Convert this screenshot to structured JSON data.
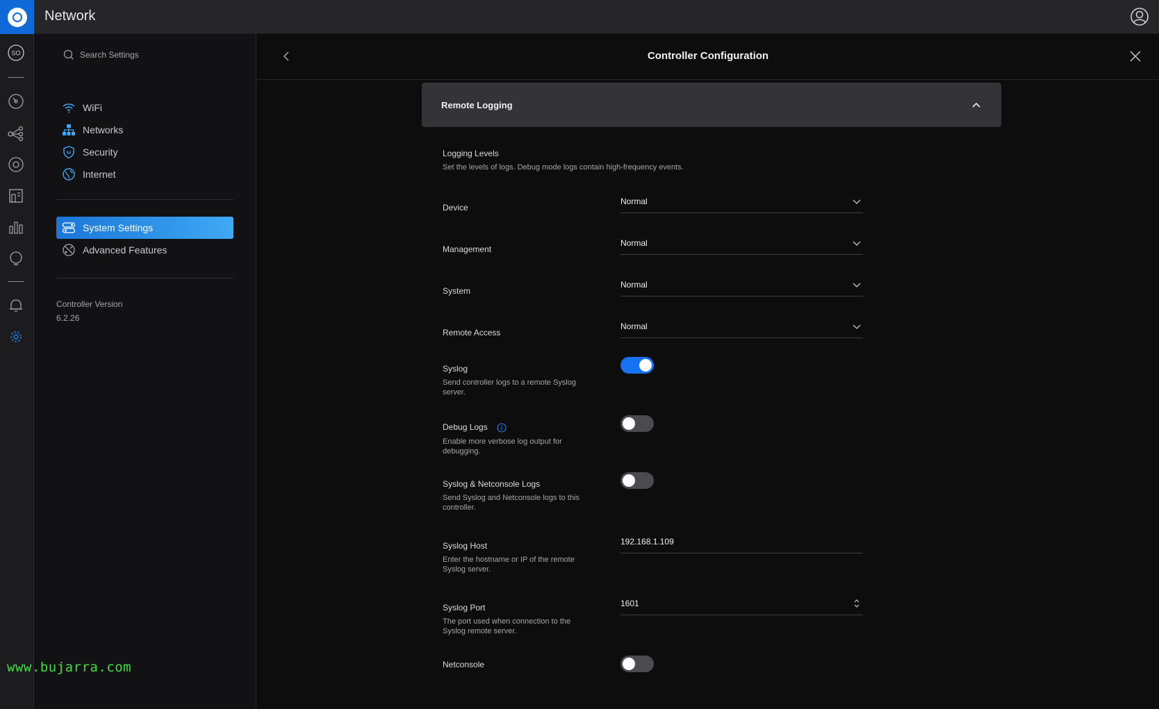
{
  "app": {
    "title": "Network"
  },
  "sidebar": {
    "search_placeholder": "Search Settings",
    "items": [
      {
        "label": "WiFi",
        "icon": "wifi-icon"
      },
      {
        "label": "Networks",
        "icon": "networks-icon"
      },
      {
        "label": "Security",
        "icon": "shield-icon"
      },
      {
        "label": "Internet",
        "icon": "globe-icon"
      }
    ],
    "items2": [
      {
        "label": "System Settings",
        "icon": "system-settings-icon",
        "active": true
      },
      {
        "label": "Advanced Features",
        "icon": "advanced-features-icon"
      }
    ],
    "version_label": "Controller Version",
    "version_value": "6.2.26"
  },
  "leftnav": {
    "icons": [
      "site-switcher-icon",
      "dashboard-icon",
      "topology-icon",
      "devices-icon",
      "clients-icon",
      "statistics-icon",
      "insights-icon",
      "alerts-icon",
      "settings-icon"
    ],
    "site_initials": "SO"
  },
  "main": {
    "title": "Controller Configuration",
    "section_title": "Remote Logging",
    "logging_levels": {
      "label": "Logging Levels",
      "desc": "Set the levels of logs. Debug mode logs contain high-frequency events."
    },
    "selects": [
      {
        "label": "Device",
        "value": "Normal"
      },
      {
        "label": "Management",
        "value": "Normal"
      },
      {
        "label": "System",
        "value": "Normal"
      },
      {
        "label": "Remote Access",
        "value": "Normal"
      }
    ],
    "syslog": {
      "label": "Syslog",
      "desc": "Send controller logs to a remote Syslog server.",
      "on": true
    },
    "debug_logs": {
      "label": "Debug Logs",
      "desc": "Enable more verbose log output for debugging.",
      "on": false
    },
    "syslog_netconsole": {
      "label": "Syslog & Netconsole Logs",
      "desc": "Send Syslog and Netconsole logs to this controller.",
      "on": false
    },
    "syslog_host": {
      "label": "Syslog Host",
      "desc": "Enter the hostname or IP of the remote Syslog server.",
      "value": "192.168.1.109"
    },
    "syslog_port": {
      "label": "Syslog Port",
      "desc": "The port used when connection to the Syslog remote server.",
      "value": "1601"
    },
    "netconsole": {
      "label": "Netconsole",
      "on": false
    }
  },
  "watermark": "www.bujarra.com",
  "colors": {
    "accent": "#1672f0",
    "logo": "#0f69d6",
    "active_start": "#1a76d8",
    "active_end": "#3fa9f5"
  }
}
